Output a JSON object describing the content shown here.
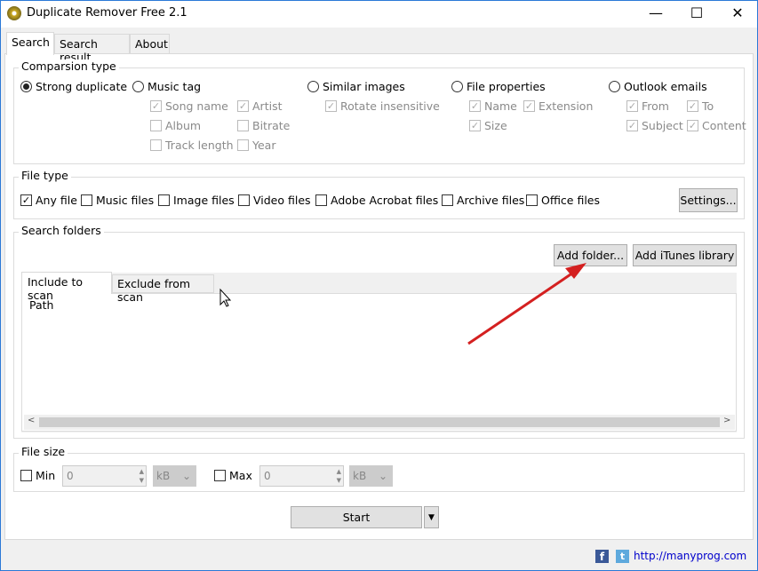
{
  "window": {
    "title": "Duplicate Remover Free 2.1",
    "minimize": "—",
    "maximize": "☐",
    "close": "✕"
  },
  "tabs": [
    "Search",
    "Search result",
    "About"
  ],
  "comparison": {
    "label": "Comparsion type",
    "radios": [
      "Strong duplicate",
      "Music tag",
      "Similar images",
      "File properties",
      "Outlook emails"
    ],
    "music": [
      "Song name",
      "Artist",
      "Album",
      "Bitrate",
      "Track length",
      "Year"
    ],
    "images": [
      "Rotate insensitive"
    ],
    "props": [
      "Name",
      "Extension",
      "Size"
    ],
    "outlook": [
      "From",
      "To",
      "Subject",
      "Content"
    ]
  },
  "file_type": {
    "label": "File type",
    "options": [
      "Any file",
      "Music files",
      "Image files",
      "Video files",
      "Adobe Acrobat files",
      "Archive files",
      "Office files"
    ],
    "settings": "Settings..."
  },
  "search_folders": {
    "label": "Search folders",
    "add_folder": "Add folder...",
    "add_itunes": "Add iTunes library",
    "tabs": [
      "Include to scan",
      "Exclude from scan"
    ],
    "column": "Path"
  },
  "file_size": {
    "label": "File size",
    "min_label": "Min",
    "min_value": "0",
    "min_unit": "kB",
    "max_label": "Max",
    "max_value": "0",
    "max_unit": "kB"
  },
  "start": "Start",
  "footer": {
    "url": "http://manyprog.com"
  }
}
